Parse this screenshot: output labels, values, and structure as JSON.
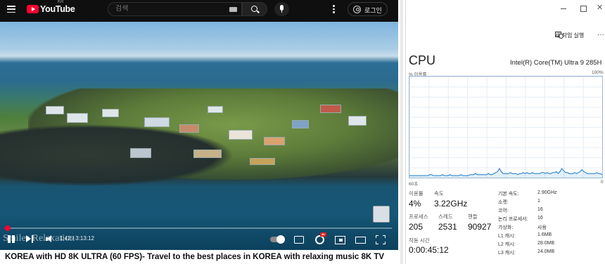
{
  "youtube": {
    "logo_text": "YouTube",
    "region": "KR",
    "search_placeholder": "검색",
    "login_label": "로그인",
    "player": {
      "current_time": "1:42",
      "duration": "3:13:12",
      "time_display": "1:42 / 3:13:12",
      "progress_fraction": 0.0088,
      "quality_badge": "4K",
      "watermark": "Smiles Relaxation"
    },
    "video_title": "KOREA with HD 8K ULTRA (60 FPS)- Travel to the best places in KOREA with relaxing music 8K TV"
  },
  "task_manager": {
    "new_task_label": "새 작업 실행",
    "more_label": "···",
    "section_title": "CPU",
    "cpu_model": "Intel(R) Core(TM) Ultra 9 285H",
    "utilization_label": "% 이용률",
    "max_percent": "100%",
    "axis_left": "60초",
    "axis_right": "0",
    "stats": {
      "utilization_label": "이용률",
      "utilization_value": "4%",
      "speed_label": "속도",
      "speed_value": "3.22GHz",
      "processes_label": "프로세스",
      "processes_value": "205",
      "threads_label": "스레드",
      "threads_value": "2531",
      "handles_label": "핸들",
      "handles_value": "90927",
      "uptime_label": "작동 시간",
      "uptime_value": "0:00:45:12"
    },
    "details": [
      {
        "key": "기본 속도:",
        "value": "2.90GHz"
      },
      {
        "key": "소켓:",
        "value": "1"
      },
      {
        "key": "코어:",
        "value": "16"
      },
      {
        "key": "논리 프로세서:",
        "value": "16"
      },
      {
        "key": "가상화:",
        "value": "사용"
      },
      {
        "key": "L1 캐시:",
        "value": "1.6MB"
      },
      {
        "key": "L2 캐시:",
        "value": "28.0MB"
      },
      {
        "key": "L3 캐시:",
        "value": "24.0MB"
      }
    ],
    "cpu_history_percent": [
      2,
      2,
      2,
      2,
      2,
      2,
      2,
      2,
      2,
      2,
      2,
      3,
      3,
      2,
      2,
      2,
      2,
      2,
      3,
      2,
      2,
      2,
      3,
      2,
      2,
      2,
      2,
      2,
      3,
      2,
      2,
      2,
      2,
      3,
      3,
      3,
      4,
      3,
      3,
      3,
      3,
      3,
      3,
      4,
      3,
      3,
      4,
      5,
      6,
      9,
      6,
      4,
      4,
      4,
      4,
      5,
      4,
      4,
      4,
      3,
      4,
      4,
      5,
      4,
      5,
      4,
      4,
      5,
      4,
      4,
      4,
      4,
      5,
      5,
      4,
      5,
      4,
      4,
      5,
      5,
      6,
      4,
      6,
      9,
      7,
      5,
      5,
      4,
      4,
      4,
      5,
      4,
      5,
      6,
      8,
      6,
      5,
      4,
      4,
      4,
      4,
      4,
      5,
      4,
      4,
      3
    ],
    "graph_color": "#1979ca"
  }
}
